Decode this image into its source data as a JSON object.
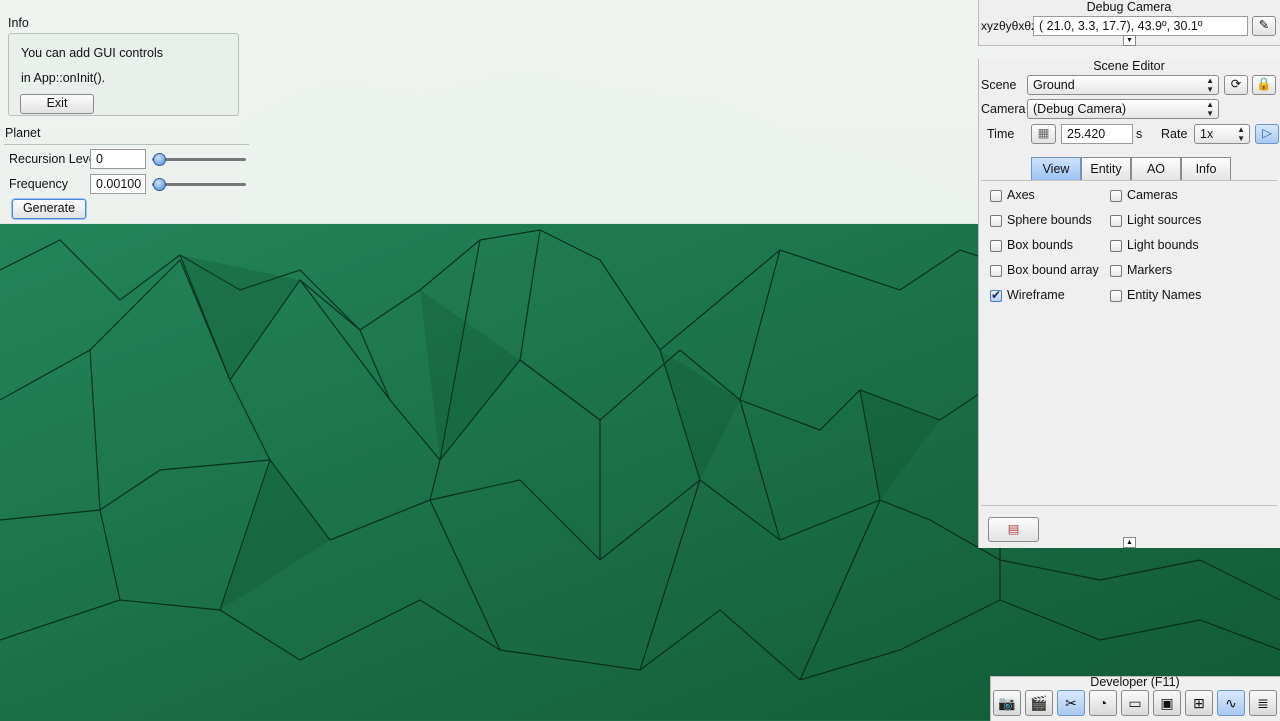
{
  "info_panel": {
    "title": "Info",
    "line1": "You can add GUI controls",
    "line2": "in App::onInit().",
    "exit_label": "Exit"
  },
  "planet_panel": {
    "title": "Planet",
    "recursion_label": "Recursion Level",
    "recursion_value": "0",
    "frequency_label": "Frequency",
    "frequency_value": "0.00100",
    "generate_label": "Generate"
  },
  "debug_camera": {
    "title": "Debug Camera",
    "coord_label": "xyzθyθxθz",
    "coord_value": "( 21.0,   3.3,  17.7),  43.9º,  30.1º"
  },
  "scene_editor": {
    "title": "Scene Editor",
    "scene_label": "Scene",
    "scene_value": "Ground",
    "camera_label": "Camera",
    "camera_value": "(Debug Camera)",
    "time_label": "Time",
    "time_value": "25.420",
    "time_unit": "s",
    "rate_label": "Rate",
    "rate_value": "1x",
    "tabs": [
      "View",
      "Entity",
      "AO",
      "Info"
    ],
    "active_tab": "View",
    "options": [
      {
        "label": "Axes",
        "checked": false
      },
      {
        "label": "Cameras",
        "checked": false
      },
      {
        "label": "Sphere bounds",
        "checked": false
      },
      {
        "label": "Light sources",
        "checked": false
      },
      {
        "label": "Box bounds",
        "checked": false
      },
      {
        "label": "Light bounds",
        "checked": false
      },
      {
        "label": "Box bound array",
        "checked": false
      },
      {
        "label": "Markers",
        "checked": false
      },
      {
        "label": "Wireframe",
        "checked": true
      },
      {
        "label": "Entity Names",
        "checked": false
      }
    ]
  },
  "developer_dock": {
    "title": "Developer (F11)",
    "buttons": [
      "camera-icon",
      "clapperboard-icon",
      "tools-icon",
      "speedometer-icon",
      "new-window-icon",
      "terminal-icon",
      "layout-icon",
      "profiler-icon",
      "log-icon"
    ]
  },
  "colors": {
    "terrain": "#1b6e46",
    "accent": "#9cc3f2"
  }
}
